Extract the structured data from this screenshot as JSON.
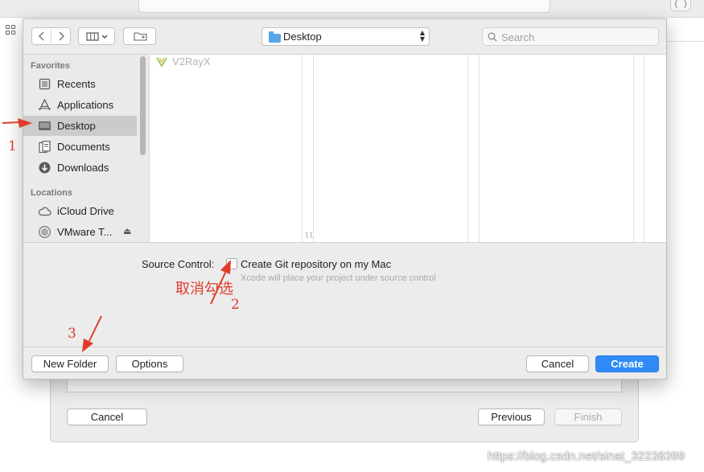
{
  "background": {
    "brace_label": "{ }",
    "buttons": {
      "cancel": "Cancel",
      "previous": "Previous",
      "finish": "Finish"
    }
  },
  "sheet": {
    "path_select": {
      "label": "Desktop",
      "icon": "folder-icon"
    },
    "search": {
      "placeholder": "Search"
    },
    "sidebar": {
      "favorites_header": "Favorites",
      "favorites": [
        {
          "label": "Recents",
          "icon": "recents-icon"
        },
        {
          "label": "Applications",
          "icon": "applications-icon"
        },
        {
          "label": "Desktop",
          "icon": "desktop-icon",
          "selected": true
        },
        {
          "label": "Documents",
          "icon": "documents-icon"
        },
        {
          "label": "Downloads",
          "icon": "downloads-icon"
        }
      ],
      "locations_header": "Locations",
      "locations": [
        {
          "label": "iCloud Drive",
          "icon": "cloud-icon"
        },
        {
          "label": "VMware T...",
          "icon": "disc-icon",
          "eject": true
        }
      ]
    },
    "browser": {
      "items": [
        {
          "label": "V2RayX",
          "icon": "v2rayx-app-icon",
          "dimmed": true
        }
      ]
    },
    "source_control": {
      "label": "Source Control:",
      "checkbox_label": "Create Git repository on my Mac",
      "checked": false,
      "hint": "Xcode will place your project under source control"
    },
    "footer": {
      "new_folder": "New Folder",
      "options": "Options",
      "cancel": "Cancel",
      "create": "Create"
    }
  },
  "annotations": {
    "step1": "1",
    "step2": "2",
    "step3": "3",
    "uncheck_note": "取消勾选",
    "color": "#e23a2c"
  },
  "watermark": "https://blog.csdn.net/sinat_32238399",
  "colors": {
    "accent": "#2f8af6",
    "sidebar_selected": "#cbcbcb",
    "annotation": "#e23a2c"
  }
}
